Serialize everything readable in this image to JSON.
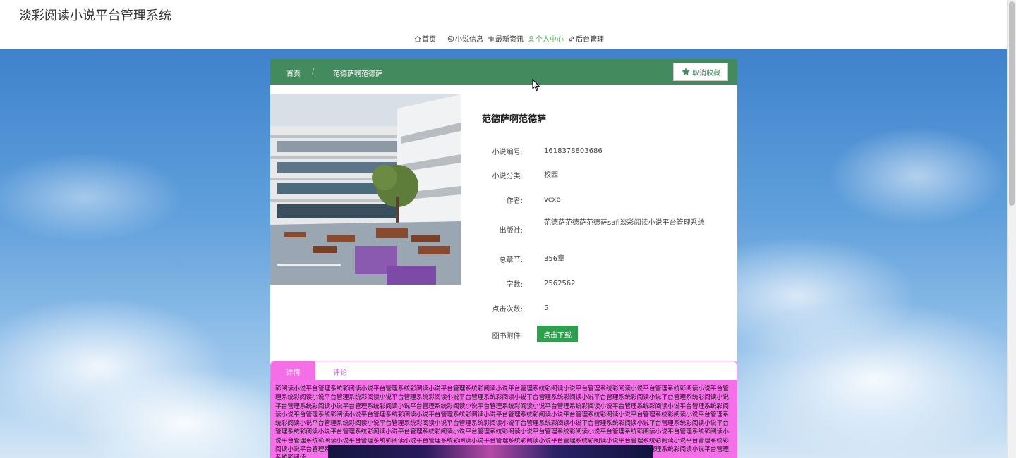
{
  "header": {
    "site_title": "淡彩阅读小说平台管理系统",
    "nav": [
      {
        "label": "首页",
        "icon": "home-icon",
        "active": false
      },
      {
        "label": "小说信息",
        "icon": "book-icon",
        "active": false
      },
      {
        "label": "最新资讯",
        "icon": "news-icon",
        "active": false
      },
      {
        "label": "个人中心",
        "icon": "user-icon",
        "active": true
      },
      {
        "label": "后台管理",
        "icon": "link-icon",
        "active": false
      }
    ]
  },
  "breadcrumb": {
    "home": "首页",
    "separator": "/",
    "current": "范德萨啊范德萨"
  },
  "favorite_button": {
    "label": "取消收藏",
    "icon": "star-icon"
  },
  "book": {
    "title": "范德萨啊范德萨",
    "fields": [
      {
        "label": "小说编号:",
        "value": "1618378803686"
      },
      {
        "label": "小说分类:",
        "value": "校园"
      },
      {
        "label": "作者:",
        "value": "vcxb"
      },
      {
        "label": "出版社:",
        "value": "范德萨范德萨范德萨safi淡彩阅读小说平台管理系统"
      },
      {
        "label": "总章节:",
        "value": "356章"
      },
      {
        "label": "字数:",
        "value": "2562562"
      },
      {
        "label": "点击次数:",
        "value": "5"
      }
    ],
    "attachment_label": "图书附件:",
    "download_label": "点击下载"
  },
  "tabs": {
    "detail": "详情",
    "comment": "评论"
  },
  "detail_text": "彩阅读小说平台管理系统彩阅读小说平台管理系统彩阅读小说平台管理系统彩阅读小说平台管理系统彩阅读小说平台管理系统彩阅读小说平台管理系统彩阅读小说平台管理系统彩阅读小说平台管理系统彩阅读小说平台管理系统彩阅读小说平台管理系统彩阅读小说平台管理系统彩阅读小说平台管理系统彩阅读小说平台管理系统彩阅读小说平台管理系统彩阅读小说平台管理系统彩阅读小说平台管理系统彩阅读小说平台管理系统彩阅读小说平台管理系统彩阅读小说平台管理系统彩阅读小说平台管理系统彩阅读小说平台管理系统彩阅读小说平台管理系统彩阅读小说平台管理系统彩阅读小说平台管理系统彩阅读小说平台管理系统彩阅读小说平台管理系统彩阅读小说平台管理系统彩阅读小说平台管理系统彩阅读小说平台管理系统彩阅读小说平台管理系统彩阅读小说平台管理系统彩阅读小说平台管理系统彩阅读小说平台管理系统彩阅读小说平台管理系统彩阅读小说平台管理系统彩阅读小说平台管理系统彩阅读小说平台管理系统彩阅读小说平台管理系统彩阅读小说平台管理系统彩阅读小说平台管理系统彩阅读小说平台管理系统彩阅读小说平台管理系统彩阅读小说平台管理系统彩阅读小说平台管理系统彩阅读小说平台管理系统彩阅读小说平台管理系统彩阅读小说平台管理系统彩阅读小说平台管理系统彩阅读小说平台管理系统彩阅读小说平台管理系统彩阅读小说平台管理系统彩阅读小说平台管理系统彩阅读小说平台管理系统彩阅读小说平台管理系统彩阅读",
  "colors": {
    "topbar": "#438a5e",
    "active_nav": "#4caf50",
    "download_button": "#2e9e4f",
    "tab_active": "#f46fe6",
    "detail_background": "#f570e8"
  }
}
